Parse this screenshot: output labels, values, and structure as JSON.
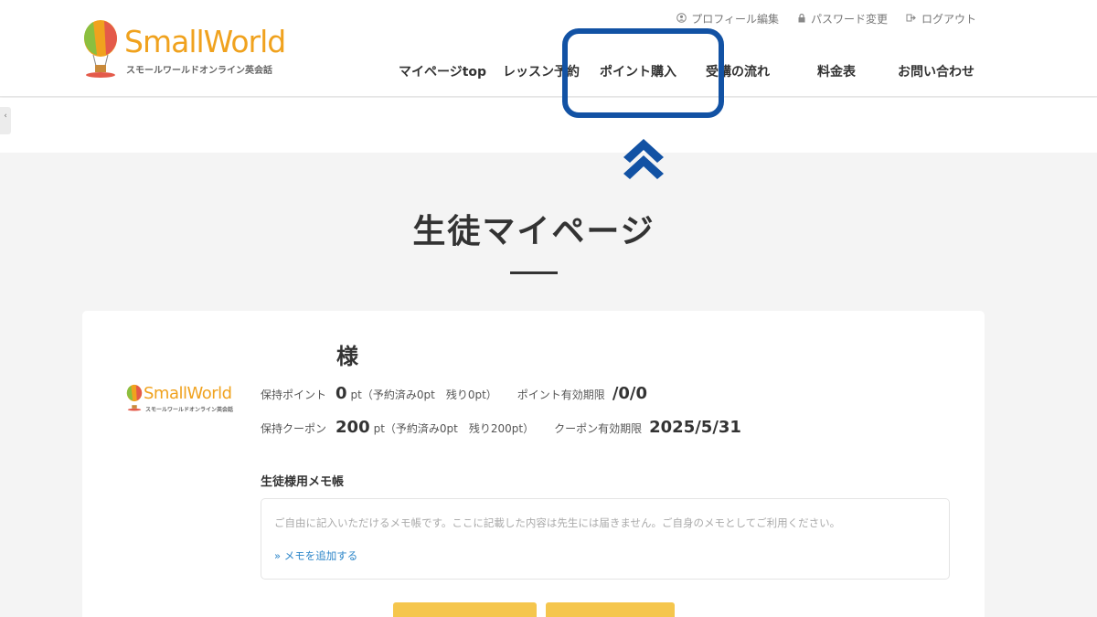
{
  "header": {
    "logo_text": "SmallWorld",
    "logo_sub": "スモールワールドオンライン英会話",
    "util_links": [
      {
        "label": "プロフィール編集",
        "icon": "person-icon"
      },
      {
        "label": "パスワード変更",
        "icon": "lock-icon"
      },
      {
        "label": "ログアウト",
        "icon": "logout-icon"
      }
    ],
    "nav": [
      {
        "label": "マイページtop"
      },
      {
        "label": "レッスン予約"
      },
      {
        "label": "ポイント購入"
      },
      {
        "label": "受講の流れ"
      },
      {
        "label": "料金表"
      },
      {
        "label": "お問い合わせ"
      }
    ]
  },
  "annotation": {
    "color": "#1252a4"
  },
  "page": {
    "title": "生徒マイページ"
  },
  "profile": {
    "name_suffix": "様",
    "points_label": "保持ポイント",
    "points_value": "0",
    "points_unit": "pt（予約済み0pt　残り0pt）",
    "points_expiry_label": "ポイント有効期限",
    "points_expiry_value": "/0/0",
    "coupon_label": "保持クーポン",
    "coupon_value": "200",
    "coupon_unit": "pt（予約済み0pt　残り200pt）",
    "coupon_expiry_label": "クーポン有効期限",
    "coupon_expiry_value": "2025/5/31"
  },
  "memo": {
    "title": "生徒様用メモ帳",
    "placeholder": "ご自由に記入いただけるメモ帳です。ここに記載した内容は先生には届きません。ご自身のメモとしてご利用ください。",
    "add_link": "» メモを追加する"
  },
  "colors": {
    "brand": "#f0a21e",
    "button": "#f5c64d",
    "link": "#2d86c9"
  }
}
